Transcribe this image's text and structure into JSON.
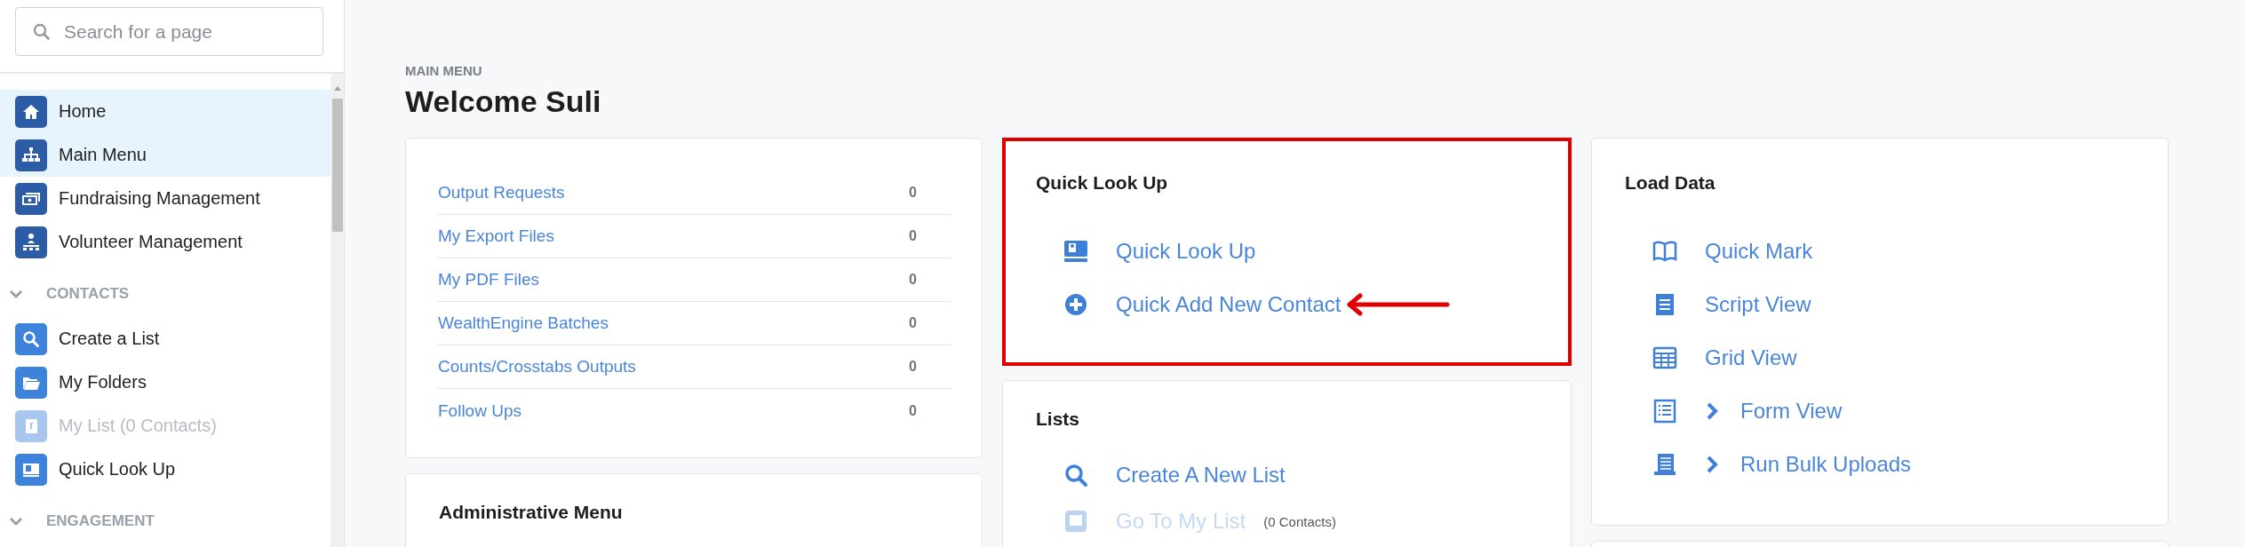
{
  "sidebar": {
    "search": {
      "placeholder": "Search for a page"
    },
    "items": [
      {
        "label": "Home",
        "selected": true,
        "disabled": false
      },
      {
        "label": "Main Menu",
        "selected": true,
        "disabled": false
      },
      {
        "label": "Fundraising Management",
        "selected": false,
        "disabled": false
      },
      {
        "label": "Volunteer Management",
        "selected": false,
        "disabled": false
      }
    ],
    "groups": [
      {
        "label": "CONTACTS",
        "expanded": true,
        "items": [
          {
            "label": "Create a List",
            "selected": false,
            "disabled": false
          },
          {
            "label": "My Folders",
            "selected": false,
            "disabled": false
          },
          {
            "label": "My List (0 Contacts)",
            "selected": false,
            "disabled": true
          },
          {
            "label": "Quick Look Up",
            "selected": false,
            "disabled": false
          }
        ]
      },
      {
        "label": "ENGAGEMENT",
        "expanded": true
      }
    ]
  },
  "header": {
    "eyebrow": "MAIN MENU",
    "title": "Welcome Suli"
  },
  "columns": [
    [
      {
        "kind": "counts",
        "rows": [
          {
            "label": "Output Requests",
            "count": "0"
          },
          {
            "label": "My Export Files",
            "count": "0"
          },
          {
            "label": "My PDF Files",
            "count": "0"
          },
          {
            "label": "WealthEngine Batches",
            "count": "0"
          },
          {
            "label": "Counts/Crosstabs Outputs",
            "count": "0"
          },
          {
            "label": "Follow Ups",
            "count": "0"
          }
        ]
      },
      {
        "kind": "links",
        "title": "Administrative Menu",
        "highlighted": false
      }
    ],
    [
      {
        "kind": "links",
        "title": "Quick Look Up",
        "highlighted": true,
        "links": [
          {
            "label": "Quick Look Up",
            "disabled": false,
            "expandable": false,
            "arrow": false
          },
          {
            "label": "Quick Add New Contact",
            "disabled": false,
            "expandable": false,
            "arrow": true
          }
        ]
      },
      {
        "kind": "links",
        "title": "Lists",
        "highlighted": false,
        "links": [
          {
            "label": "Create A New List",
            "disabled": false,
            "expandable": false,
            "arrow": false
          },
          {
            "label": "Go To My List",
            "note": "(0 Contacts)",
            "disabled": true,
            "expandable": false,
            "arrow": false
          }
        ]
      }
    ],
    [
      {
        "kind": "links",
        "title": "Load Data",
        "highlighted": false,
        "links": [
          {
            "label": "Quick Mark",
            "disabled": false,
            "expandable": false,
            "arrow": false
          },
          {
            "label": "Script View",
            "disabled": false,
            "expandable": false,
            "arrow": false
          },
          {
            "label": "Grid View",
            "disabled": false,
            "expandable": false,
            "arrow": false
          },
          {
            "label": "Form View",
            "disabled": false,
            "expandable": true,
            "arrow": false
          },
          {
            "label": "Run Bulk Uploads",
            "disabled": false,
            "expandable": true,
            "arrow": false
          }
        ]
      },
      {
        "kind": "links",
        "highlighted": false
      }
    ]
  ]
}
